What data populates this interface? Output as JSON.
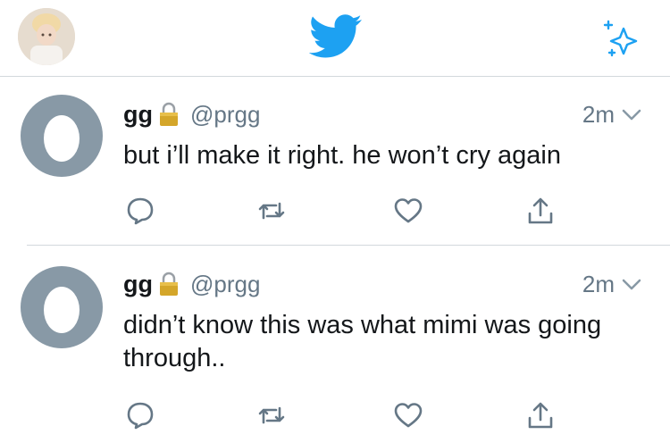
{
  "topbar": {
    "profile_icon": "profile-avatar",
    "logo_icon": "twitter-bird-icon",
    "sparkle_icon": "sparkle-icon",
    "brand_color": "#1da1f2"
  },
  "tweets": [
    {
      "name": "gg",
      "handle": "@prgg",
      "time": "2m",
      "text": "but i’ll make it right. he won’t cry again"
    },
    {
      "name": "gg",
      "handle": "@prgg",
      "time": "2m",
      "text": "didn’t know this was what mimi was going through.."
    }
  ],
  "colors": {
    "text": "#14171a",
    "secondary": "#657786",
    "egg_avatar": "#8899a6",
    "divider": "#d3d8dc"
  }
}
